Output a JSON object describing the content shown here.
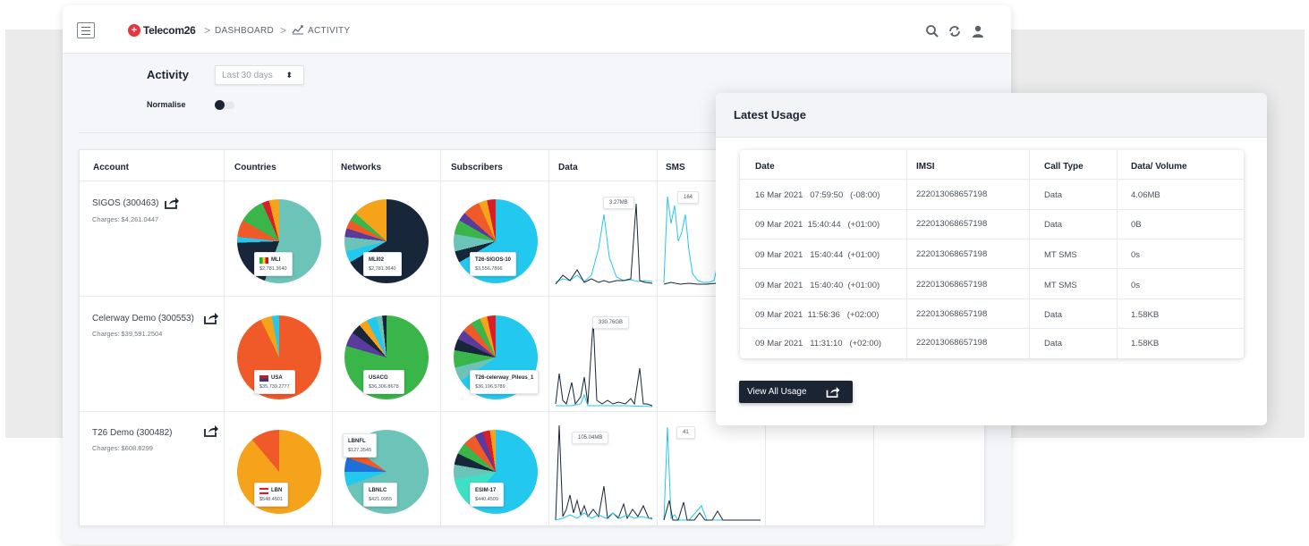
{
  "header": {
    "brand": "Telecom26",
    "brand_mark": "+",
    "breadcrumb_dashboard": "DASHBOARD",
    "breadcrumb_activity": "ACTIVITY",
    "sep": ">",
    "icons": [
      "menu-icon",
      "search-icon",
      "refresh-icon",
      "user-icon"
    ]
  },
  "controls": {
    "activity_label": "Activity",
    "period_value": "Last 30 days",
    "period_arrow": "⬍",
    "normalise_label": "Normalise",
    "normalise_on": false
  },
  "grid": {
    "columns": [
      "Account",
      "Countries",
      "Networks",
      "Subscribers",
      "Data",
      "SMS"
    ],
    "accounts": [
      {
        "name": "SIGOS (300463)",
        "charges": "Charges: $4,261.0447",
        "country": {
          "name": "MLI",
          "value": "$2,781.3640"
        },
        "network": {
          "name": "MLI02",
          "value": "$2,781.3640"
        },
        "subscriber": {
          "name": "T26-SIGOS-10",
          "value": "$3,556.7866"
        },
        "data_peak": "3.27MB",
        "sms_peak": "164"
      },
      {
        "name": "Celerway Demo (300553)",
        "charges": "Charges: $39,591.2504",
        "country": {
          "name": "USA",
          "value": "$35,739.2777"
        },
        "network": {
          "name": "USACG",
          "value": "$36,306.8678"
        },
        "subscriber": {
          "name": "T26-celerway_Pileus_1",
          "value": "$36,196.5789"
        },
        "data_peak": "330.76GB",
        "sms_peak": ""
      },
      {
        "name": "T26 Demo (300482)",
        "charges": "Charges: $608.8299",
        "country": {
          "name": "LBN",
          "value": "$548.4501"
        },
        "network": {
          "name": "LBNLC",
          "value": "$421.0955"
        },
        "network_extra": {
          "name": "LBNFL",
          "value": "$127.3545"
        },
        "subscriber": {
          "name": "ESIM-17",
          "value": "$440.4509"
        },
        "data_peak": "105.04MB",
        "sms_peak": "41"
      }
    ],
    "colors": {
      "teal": "#6cc3b8",
      "navy": "#172638",
      "cyan": "#23c8ee",
      "orange": "#f5a31a",
      "red": "#f05a28",
      "green": "#3ab54a"
    }
  },
  "usage_panel": {
    "title": "Latest Usage",
    "columns": [
      "Date",
      "IMSI",
      "Call Type",
      "Data/ Volume"
    ],
    "rows": [
      {
        "date": "16 Mar 2021   07:59:50   (-08:00)",
        "imsi": "222013068657198",
        "type": "Data",
        "volume": "4.06MB"
      },
      {
        "date": "09 Mar 2021  15:40:44   (+01:00)",
        "imsi": "222013068657198",
        "type": "Data",
        "volume": "0B"
      },
      {
        "date": "09 Mar 2021   15:40:44  (+01:00)",
        "imsi": "222013068657198",
        "type": "MT SMS",
        "volume": "0s"
      },
      {
        "date": "09 Mar 2021   15:40:40  (+01:00)",
        "imsi": "222013068657198",
        "type": "MT SMS",
        "volume": "0s"
      },
      {
        "date": "09 Mar 2021  11:56:36   (+02:00)",
        "imsi": "222013068657198",
        "type": "Data",
        "volume": "1.58KB"
      },
      {
        "date": "09 Mar 2021   11:31:10   (+02:00)",
        "imsi": "222013068657198",
        "type": "Data",
        "volume": "1.58KB"
      }
    ],
    "button": "View All Usage"
  }
}
